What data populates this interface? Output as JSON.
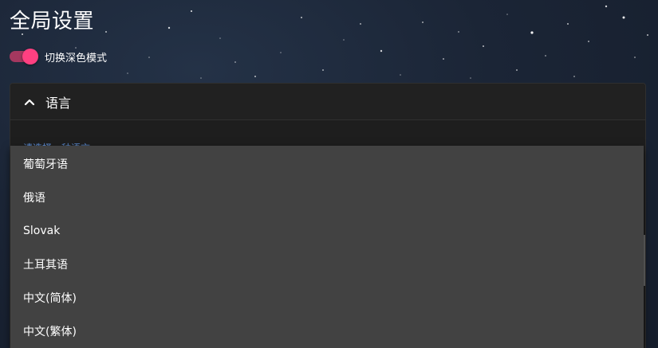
{
  "page": {
    "title": "全局设置"
  },
  "dark_mode": {
    "label": "切换深色模式",
    "enabled": true,
    "accent": "#ff4081"
  },
  "language_panel": {
    "title": "语言",
    "expanded": true,
    "hint": "请选择一种语言",
    "chevron": "chevron-up-icon"
  },
  "language_dropdown": {
    "options": [
      "葡萄牙语",
      "俄语",
      "Slovak",
      "土耳其语",
      "中文(简体)",
      "中文(繁体)"
    ]
  },
  "colors": {
    "panel_bg": "#1e1e1e",
    "menu_bg": "#424242",
    "hint": "#5d8ed6"
  }
}
